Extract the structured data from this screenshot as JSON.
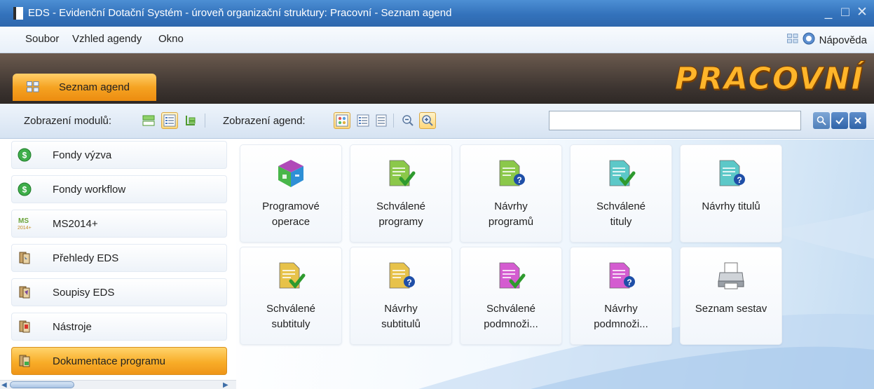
{
  "window": {
    "title": "EDS - Evidenční Dotační Systém - úroveň organizační struktury: Pracovní - Seznam agend",
    "minimize_glyph": "_",
    "maximize_glyph": "□",
    "close_glyph": "✕"
  },
  "menu": {
    "items": [
      "Soubor",
      "Vzhled agendy",
      "Okno"
    ],
    "help_label": "Nápověda"
  },
  "tab": {
    "label": "Seznam agend",
    "brand": "PRACOVNÍ"
  },
  "toolbar": {
    "modules_label": "Zobrazení modulů:",
    "agendas_label": "Zobrazení agend:",
    "search": {
      "value": "",
      "placeholder": ""
    }
  },
  "sidebar": {
    "items": [
      {
        "label": "Fondy výzva",
        "icon": "money-coin-icon",
        "active": false
      },
      {
        "label": "Fondy workflow",
        "icon": "money-coin-icon",
        "active": false
      },
      {
        "label": "MS2014+",
        "icon": "ms2014-logo-icon",
        "active": false
      },
      {
        "label": "Přehledy EDS",
        "icon": "overview-book-icon",
        "active": false
      },
      {
        "label": "Soupisy EDS",
        "icon": "list-book-icon",
        "active": false
      },
      {
        "label": "Nástroje",
        "icon": "tools-book-icon",
        "active": false
      },
      {
        "label": "Dokumentace programu",
        "icon": "documentation-book-icon",
        "active": true
      }
    ]
  },
  "tiles": [
    {
      "label": "Programové\noperace",
      "icon": "program-cube-icon"
    },
    {
      "label": "Schválené\nprogramy",
      "icon": "approved-doc-icon",
      "doc_color": "#8bc84a"
    },
    {
      "label": "Návrhy\nprogramů",
      "icon": "draft-doc-icon",
      "doc_color": "#8bc84a"
    },
    {
      "label": "Schválené\ntituly",
      "icon": "approved-doc-icon",
      "doc_color": "#5cc8c8"
    },
    {
      "label": "Návrhy titulů",
      "icon": "draft-doc-icon",
      "doc_color": "#5cc8c8"
    },
    {
      "label": "Schválené\nsubtituly",
      "icon": "approved-doc-icon",
      "doc_color": "#e7c24a"
    },
    {
      "label": "Návrhy\nsubtitulů",
      "icon": "draft-doc-icon",
      "doc_color": "#e7c24a"
    },
    {
      "label": "Schválené\npodmnoži...",
      "icon": "approved-doc-icon",
      "doc_color": "#d45cd0"
    },
    {
      "label": "Návrhy\npodmnoži...",
      "icon": "draft-doc-icon",
      "doc_color": "#d45cd0"
    },
    {
      "label": "Seznam sestav",
      "icon": "printer-icon"
    }
  ],
  "colors": {
    "accent_orange": "#f5a322",
    "title_blue": "#3372bb",
    "brand_gold": "#ffb52a"
  }
}
